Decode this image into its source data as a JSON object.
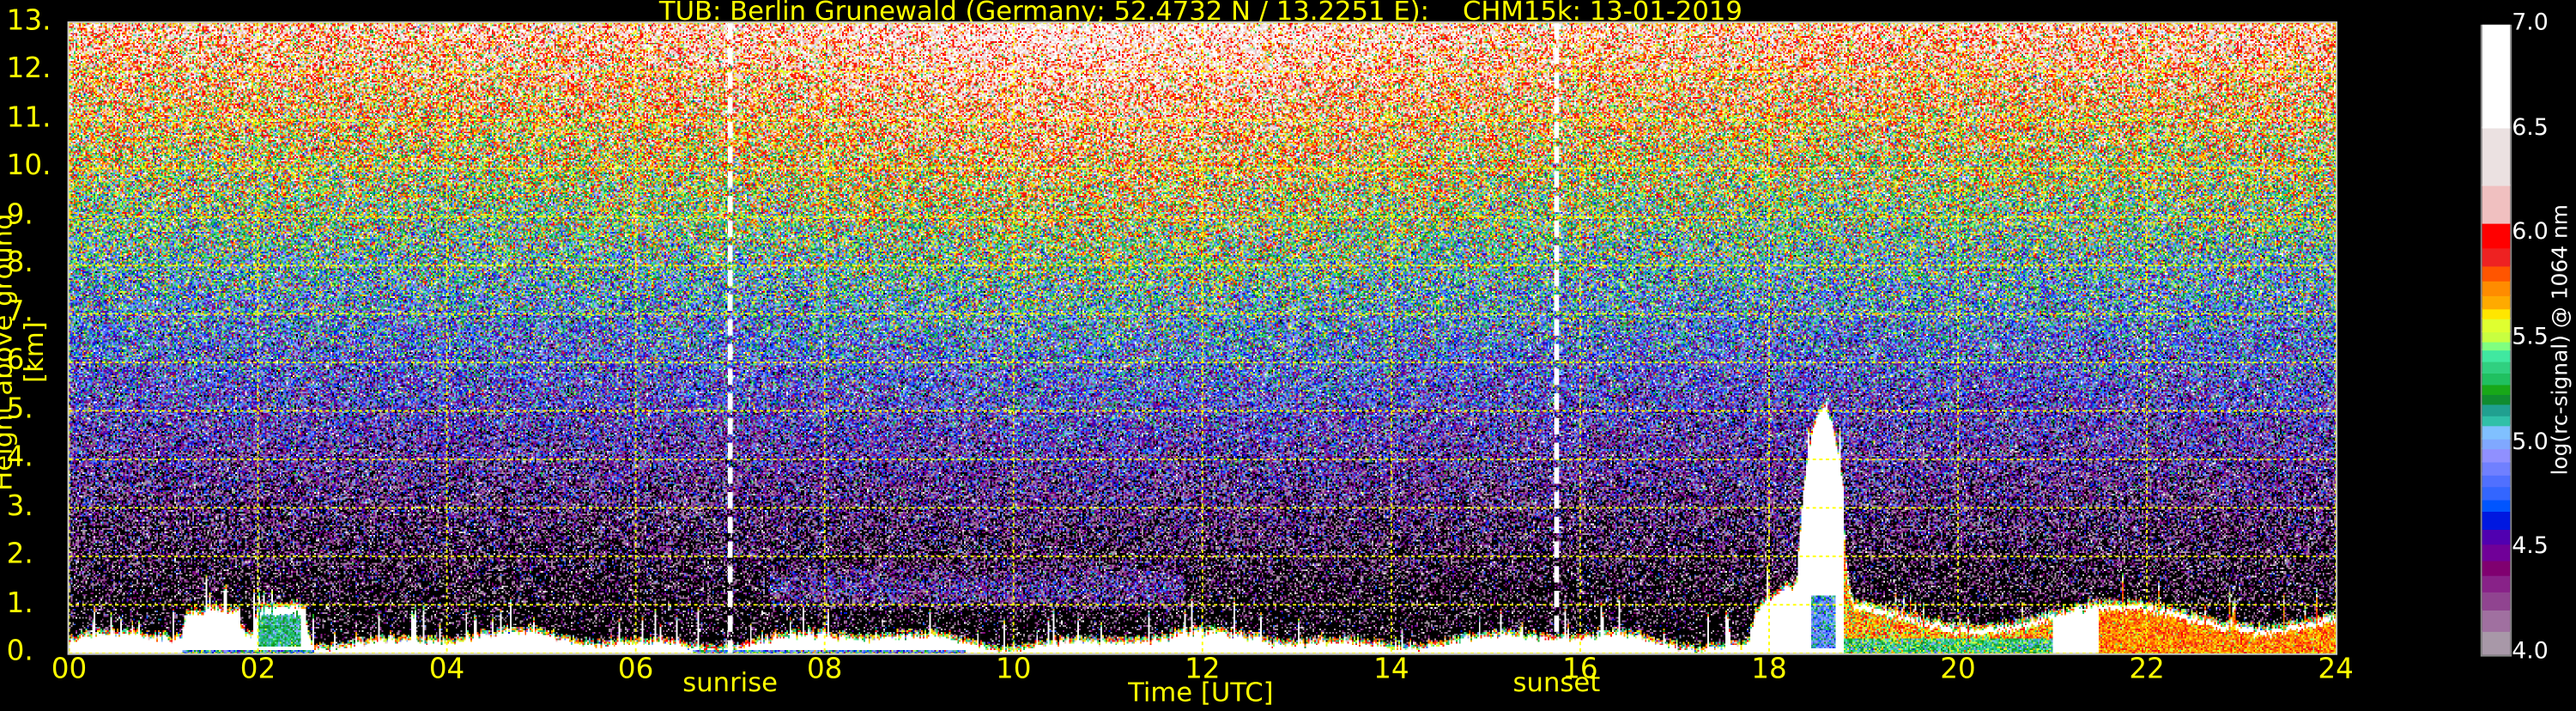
{
  "chart_data": {
    "type": "heatmap",
    "title": "TUB: Berlin Grunewald (Germany; 52.4732 N / 13.2251 E):    CHM15k: 13-01-2019",
    "xlabel": "Time [UTC]",
    "ylabel": "Height above ground [km]",
    "xlim": [
      0,
      24
    ],
    "ylim": [
      0,
      13
    ],
    "x_ticks": [
      0,
      2,
      4,
      6,
      8,
      10,
      12,
      14,
      16,
      18,
      20,
      22,
      24
    ],
    "x_tick_labels": [
      "00",
      "02",
      "04",
      "06",
      "08",
      "10",
      "12",
      "14",
      "16",
      "18",
      "20",
      "22",
      "24"
    ],
    "y_ticks": [
      0,
      1,
      2,
      3,
      4,
      5,
      6,
      7,
      8,
      9,
      10,
      11,
      12,
      13
    ],
    "y_tick_labels": [
      "0.",
      "1.",
      "2.",
      "3.",
      "4.",
      "5.",
      "6.",
      "7.",
      "8.",
      "9.",
      "10.",
      "11.",
      "12.",
      "13."
    ],
    "grid": true,
    "events": [
      {
        "label": "sunrise",
        "time": 7.0
      },
      {
        "label": "sunset",
        "time": 15.75
      }
    ],
    "colorbar": {
      "label": "log(rc-signal) @ 1064 nm",
      "range": [
        4.0,
        7.0
      ],
      "tick_values": [
        4.0,
        4.5,
        5.0,
        5.5,
        6.0,
        6.5,
        7.0
      ],
      "tick_labels": [
        "4.0",
        "4.5",
        "5.0",
        "5.5",
        "6.0",
        "6.5",
        "7.0"
      ],
      "level_bounds": [
        4.0,
        4.11,
        4.21,
        4.3,
        4.38,
        4.45,
        4.53,
        4.6,
        4.68,
        4.74,
        4.8,
        4.86,
        4.92,
        4.98,
        5.03,
        5.09,
        5.14,
        5.19,
        5.24,
        5.29,
        5.34,
        5.4,
        5.45,
        5.49,
        5.54,
        5.6,
        5.65,
        5.71,
        5.78,
        5.85,
        5.94,
        6.06,
        6.24,
        6.51,
        7.0
      ],
      "colors": [
        "#a898a8",
        "#a070a0",
        "#904490",
        "#882288",
        "#800070",
        "#700098",
        "#5000b0",
        "#0018e0",
        "#0055ff",
        "#3366ff",
        "#5070ff",
        "#7080ff",
        "#9090ff",
        "#80a8ff",
        "#80c0ff",
        "#30c0a8",
        "#20a090",
        "#108c30",
        "#18a818",
        "#20c060",
        "#30d080",
        "#40e8a0",
        "#80ff80",
        "#c8ff40",
        "#dfff30",
        "#ffe600",
        "#ffaa00",
        "#ff8c00",
        "#ff5500",
        "#ee2222",
        "#ff0000",
        "#f0c0c0",
        "#ebe1e1",
        "#ffffff"
      ]
    },
    "features": {
      "boundary_layer_top_km_typical": 0.5,
      "cloud_time_range": [
        18.3,
        18.8
      ],
      "cloud_top_km": 5.3,
      "aerosol_layer_time_range": [
        18.8,
        24
      ],
      "aerosol_layer_top_km": 1.3
    }
  },
  "colors": {
    "text": "#ffff00",
    "grid": "#ffff00",
    "colorbar_text": "#ffffff"
  }
}
